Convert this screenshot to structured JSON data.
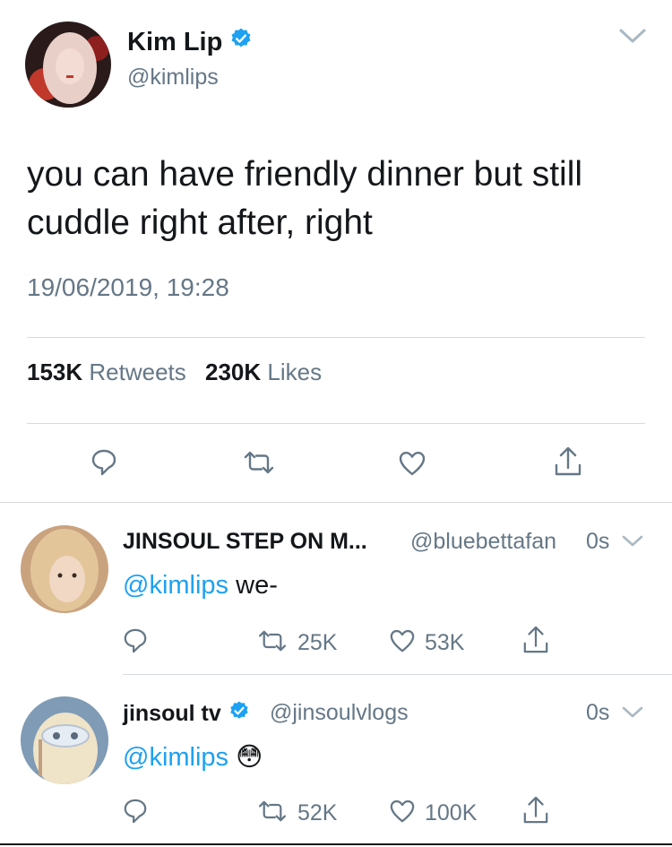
{
  "main_tweet": {
    "display_name": "Kim Lip",
    "handle": "@kimlips",
    "text": "you can have friendly dinner but still cuddle right after, right",
    "timestamp": "19/06/2019, 19:28",
    "retweets_count": "153K",
    "retweets_label": "Retweets",
    "likes_count": "230K",
    "likes_label": "Likes"
  },
  "replies": [
    {
      "display_name": "JINSOUL STEP ON M...",
      "handle": "@bluebettafan",
      "time": "0s",
      "mention": "@kimlips",
      "text": " we-",
      "retweets": "25K",
      "likes": "53K"
    },
    {
      "display_name": "jinsoul tv",
      "handle": "@jinsoulvlogs",
      "time": "0s",
      "mention": "@kimlips",
      "text": " 😳",
      "retweets": "52K",
      "likes": "100K"
    }
  ],
  "icons": [
    "verified-badge-icon",
    "chevron-down-icon",
    "reply-icon",
    "retweet-icon",
    "like-icon",
    "share-icon"
  ],
  "colors": {
    "accent": "#1da1f2",
    "secondary_text": "#657786",
    "divider": "#d6dbe0"
  }
}
